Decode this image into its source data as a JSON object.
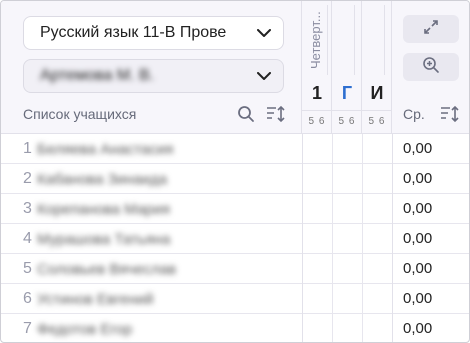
{
  "class_select": {
    "value": "Русский язык 11-В Прове"
  },
  "teacher_select": {
    "value": "Артемова М. В."
  },
  "student_list": {
    "title": "Список учащихся",
    "students": [
      {
        "num": "1",
        "name": "Беляева Анастасия",
        "avg": "0,00"
      },
      {
        "num": "2",
        "name": "Кабанова Зинаида",
        "avg": "0,00"
      },
      {
        "num": "3",
        "name": "Корепанова Мария",
        "avg": "0,00"
      },
      {
        "num": "4",
        "name": "Мурашова Татьяна",
        "avg": "0,00"
      },
      {
        "num": "5",
        "name": "Соловьев Вячеслав",
        "avg": "0,00"
      },
      {
        "num": "6",
        "name": "Устинов Евгений",
        "avg": "0,00"
      },
      {
        "num": "7",
        "name": "Федотов Егор",
        "avg": "0,00"
      }
    ]
  },
  "columns": {
    "period_label": "Четверт...",
    "col1_letter": "1",
    "col2_letter": "Г",
    "col3_letter": "И",
    "sub_label": "5 6"
  },
  "average": {
    "label": "Ср."
  },
  "icons": {
    "search": "search-icon",
    "sort": "sort-icon",
    "expand": "expand-icon",
    "zoom": "zoom-in-icon",
    "chevron": "chevron-down-icon"
  },
  "colors": {
    "accent_blue": "#2e6fd0"
  }
}
